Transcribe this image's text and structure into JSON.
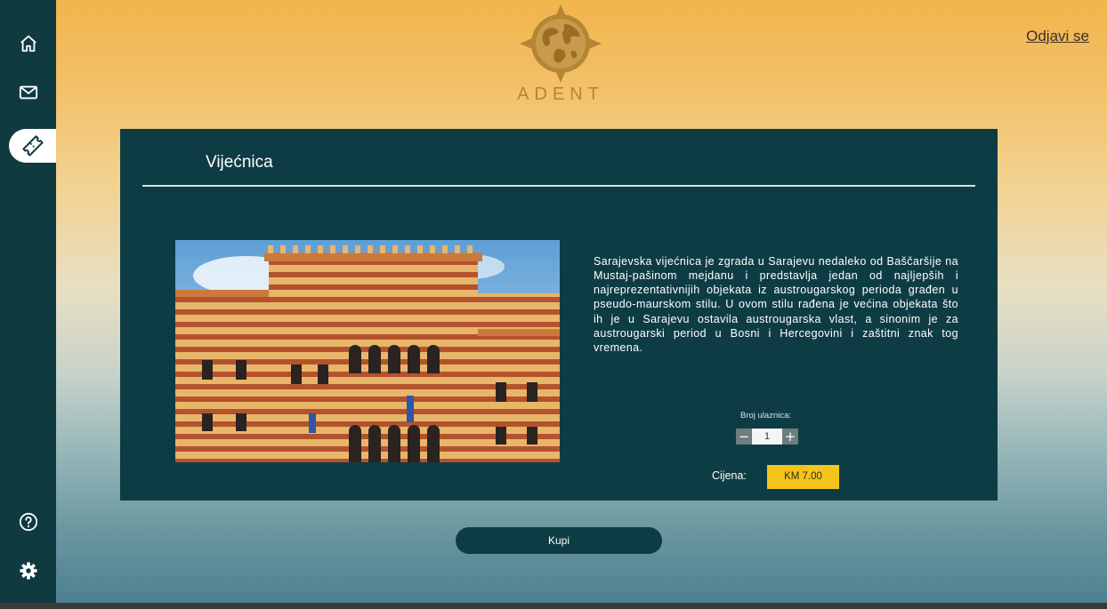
{
  "app": {
    "logo_text": "ADENT"
  },
  "header": {
    "logout_label": "Odjavi se"
  },
  "sidebar": {
    "items": [
      {
        "icon": "home-icon"
      },
      {
        "icon": "mail-icon"
      },
      {
        "icon": "ticket-icon",
        "active": true
      },
      {
        "icon": "help-icon"
      },
      {
        "icon": "settings-icon"
      }
    ]
  },
  "attraction": {
    "title": "Vijećnica",
    "description": "Sarajevska vijećnica je zgrada u Sarajevu nedaleko od Baščaršije na Mustaj-pašinom mejdanu i predstavlja jedan od najljepših i najreprezentativnijih objekata iz austrougarskog perioda građen u pseudo-maurskom stilu. U ovom stilu rađena je većina objekata što ih je u Sarajevu ostavila austrougarska vlast, a sinonim je za austrougarski period u Bosni i Hercegovini i zaštitni znak tog vremena.",
    "ticket_label": "Broj ulaznica:",
    "quantity": "1",
    "decrement": "−",
    "increment": "+",
    "price_label": "Cijena:",
    "price": "KM 7.00"
  },
  "actions": {
    "buy_label": "Kupi"
  },
  "colors": {
    "sidebar": "#0e3a40",
    "card": "#0e3c45",
    "accent_gold": "#b58536",
    "price_badge": "#f3c51c"
  }
}
